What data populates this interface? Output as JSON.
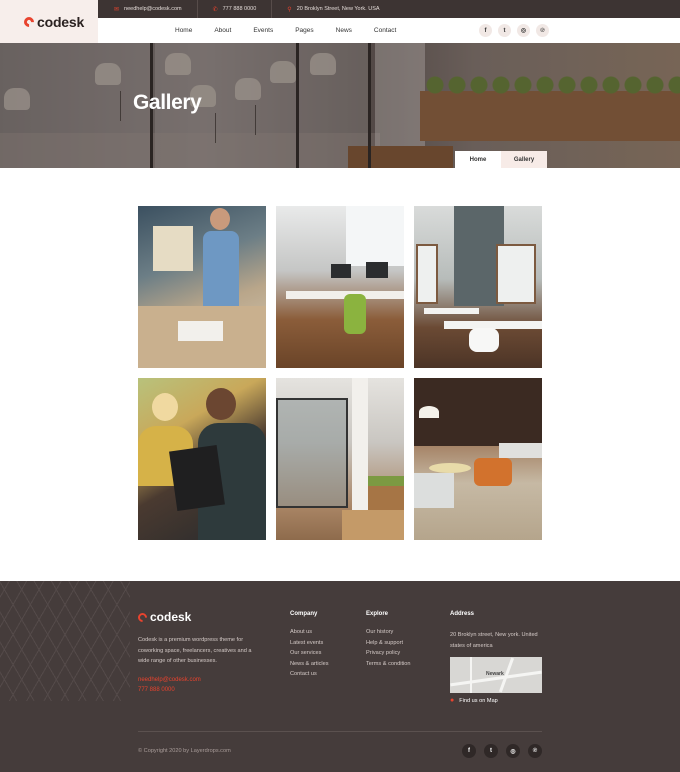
{
  "brand": {
    "name": "codesk"
  },
  "topbar": {
    "email": "needhelp@codesk.com",
    "phone": "777 888 0000",
    "address": "20 Broklyn Street, New York. USA"
  },
  "nav": {
    "items": [
      "Home",
      "About",
      "Events",
      "Pages",
      "News",
      "Contact"
    ]
  },
  "social": {
    "facebook": "f",
    "twitter": "t",
    "instagram": "◎",
    "pinterest": "℗"
  },
  "hero": {
    "title": "Gallery",
    "breadcrumb": [
      "Home",
      "Gallery"
    ]
  },
  "gallery": {
    "images": [
      "team-meeting-photo",
      "open-office-photo",
      "office-desks-photo",
      "tablet-discussion-photo",
      "glass-room-photo",
      "lounge-chair-photo"
    ]
  },
  "footer": {
    "description": "Codesk is a premium wordpress theme for coworking space, freelancers, creatives and a wide range of other businesses.",
    "email": "needhelp@codesk.com",
    "phone": "777 888 0000",
    "company": {
      "heading": "Company",
      "links": [
        "About us",
        "Latest events",
        "Our services",
        "News & articles",
        "Contact us"
      ]
    },
    "explore": {
      "heading": "Explore",
      "links": [
        "Our history",
        "Help & support",
        "Privacy policy",
        "Terms & condition"
      ]
    },
    "address": {
      "heading": "Address",
      "text": "20 Broklyn street, New york. United states of america",
      "map_label": "Newark",
      "map_link": "Find us on Map"
    },
    "copyright": "© Copyright 2020 by Layerdrops.com"
  },
  "colors": {
    "accent": "#e8432e",
    "dark": "#3d3433",
    "footer": "#453c3b",
    "tint": "#f7eeeb"
  }
}
